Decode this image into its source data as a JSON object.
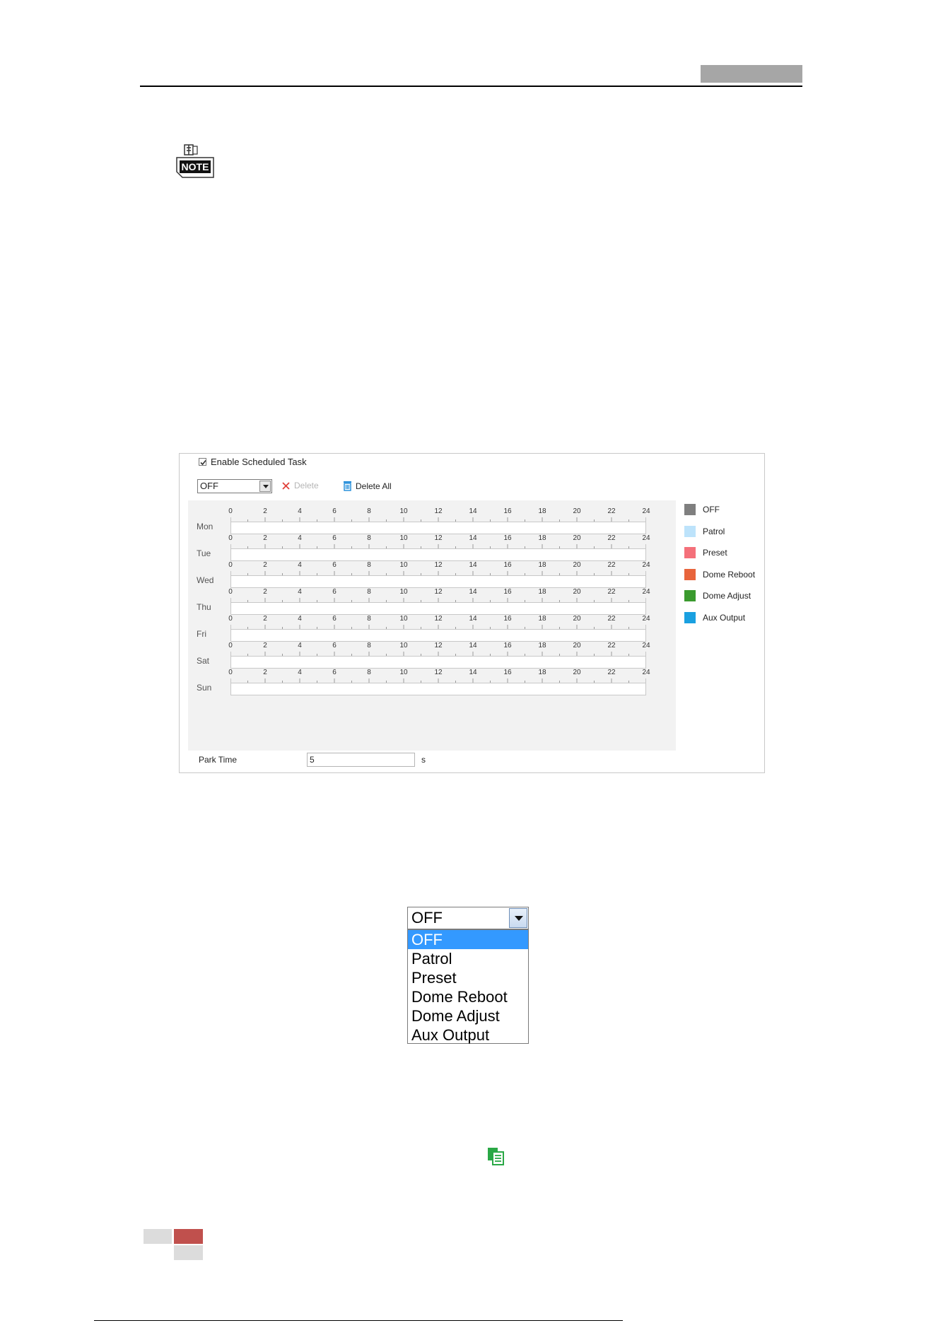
{
  "schedule": {
    "enable_label": "Enable Scheduled Task",
    "enabled": true,
    "task_select_value": "OFF",
    "delete_label": "Delete",
    "delete_all_label": "Delete All",
    "days": [
      "Mon",
      "Tue",
      "Wed",
      "Thu",
      "Fri",
      "Sat",
      "Sun"
    ],
    "hour_labels": [
      "0",
      "2",
      "4",
      "6",
      "8",
      "10",
      "12",
      "14",
      "16",
      "18",
      "20",
      "22",
      "24"
    ],
    "legend": [
      {
        "label": "OFF",
        "color": "#7f7f7f"
      },
      {
        "label": "Patrol",
        "color": "#bde3fb"
      },
      {
        "label": "Preset",
        "color": "#f4707a"
      },
      {
        "label": "Dome Reboot",
        "color": "#e8643c"
      },
      {
        "label": "Dome Adjust",
        "color": "#3a9a2e"
      },
      {
        "label": "Aux Output",
        "color": "#1aa0e0"
      }
    ],
    "park_time_label": "Park Time",
    "park_time_value": "5",
    "park_time_unit": "s"
  },
  "dropdown": {
    "selected_value": "OFF",
    "options": [
      "OFF",
      "Patrol",
      "Preset",
      "Dome Reboot",
      "Dome Adjust",
      "Aux Output"
    ],
    "highlighted_option": "OFF"
  },
  "icons": {
    "note": "note-icon",
    "copy": "copy-icon",
    "delete": "close-icon",
    "delete_all": "trash-icon"
  },
  "colors": {
    "accent_red": "#c0504d",
    "highlight_blue": "#3399ff",
    "delete_all_icon": "#1a88d8",
    "delete_icon": "#e0403a",
    "copy_icon": "#2aa846"
  }
}
